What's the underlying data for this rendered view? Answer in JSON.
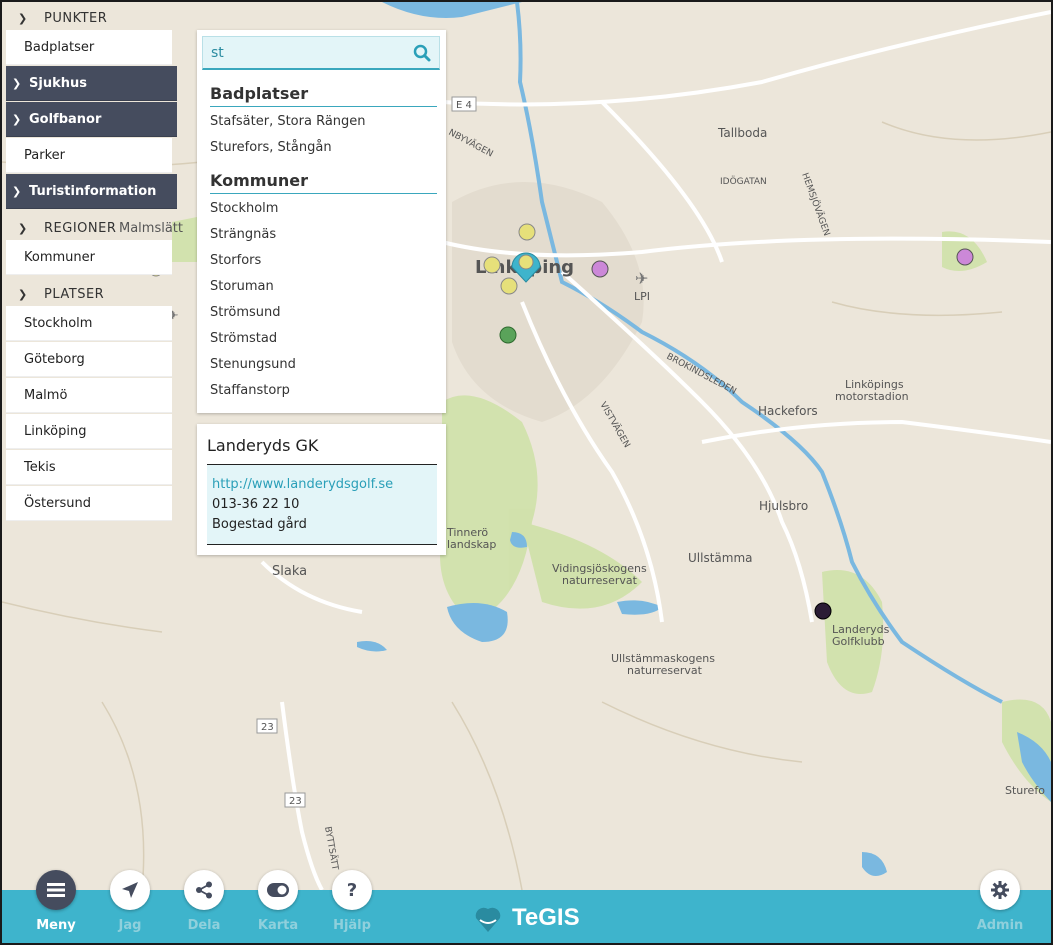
{
  "menu": {
    "sections": [
      {
        "title": "PUNKTER"
      },
      {
        "title": "REGIONER"
      },
      {
        "title": "PLATSER"
      }
    ],
    "punkter": [
      "Badplatser",
      "Sjukhus",
      "Golfbanor",
      "Parker",
      "Turistinformation"
    ],
    "regioner": [
      "Kommuner"
    ],
    "platser": [
      "Stockholm",
      "Göteborg",
      "Malmö",
      "Linköping",
      "Tekis",
      "Östersund"
    ]
  },
  "search": {
    "value": "st",
    "groups": [
      {
        "title": "Badplatser",
        "items": [
          "Stafsäter, Stora Rängen",
          "Sturefors, Stångån"
        ]
      },
      {
        "title": "Kommuner",
        "items": [
          "Stockholm",
          "Strängnäs",
          "Storfors",
          "Storuman",
          "Strömsund",
          "Strömstad",
          "Stenungsund",
          "Staffanstorp"
        ]
      }
    ]
  },
  "info": {
    "title": "Landeryds GK",
    "url": "http://www.landerydsgolf.se",
    "phone": "013-36 22 10",
    "address": "Bogestad gård"
  },
  "toolbar": {
    "buttons": [
      {
        "label": "Meny",
        "icon": "hamburger-icon"
      },
      {
        "label": "Jag",
        "icon": "location-arrow-icon"
      },
      {
        "label": "Dela",
        "icon": "share-icon"
      },
      {
        "label": "Karta",
        "icon": "toggle-icon"
      },
      {
        "label": "Hjälp",
        "icon": "question-icon"
      }
    ],
    "admin": {
      "label": "Admin",
      "icon": "gear-icon"
    },
    "logo": "TeGIS"
  },
  "map": {
    "labels": [
      "E 4",
      "Tallboda",
      "IDÖGATAN",
      "HEMSJÖVÄGEN",
      "LPI",
      "Malmslätt",
      "Linköping",
      "BROKINDSLEDEN",
      "Linköpings",
      "motorstadion",
      "Hackefors",
      "VISTVÄGEN",
      "Hjulsbro",
      "Tinnerö",
      "landskap",
      "Ullstämma",
      "Vidingsjöskogens",
      "naturreservat",
      "Slaka",
      "Landeryds",
      "Golfklubb",
      "Ullstämmaskogens",
      "naturreservat",
      "23",
      "23",
      "Sturefo",
      "BYTTSÄTT",
      "NBYVÄGEN"
    ]
  },
  "colors": {
    "accent": "#3eb4cc",
    "dark": "#454c5e",
    "map_bg": "#ece6da",
    "water": "#7ab8e0",
    "green": "#c9dda3"
  }
}
